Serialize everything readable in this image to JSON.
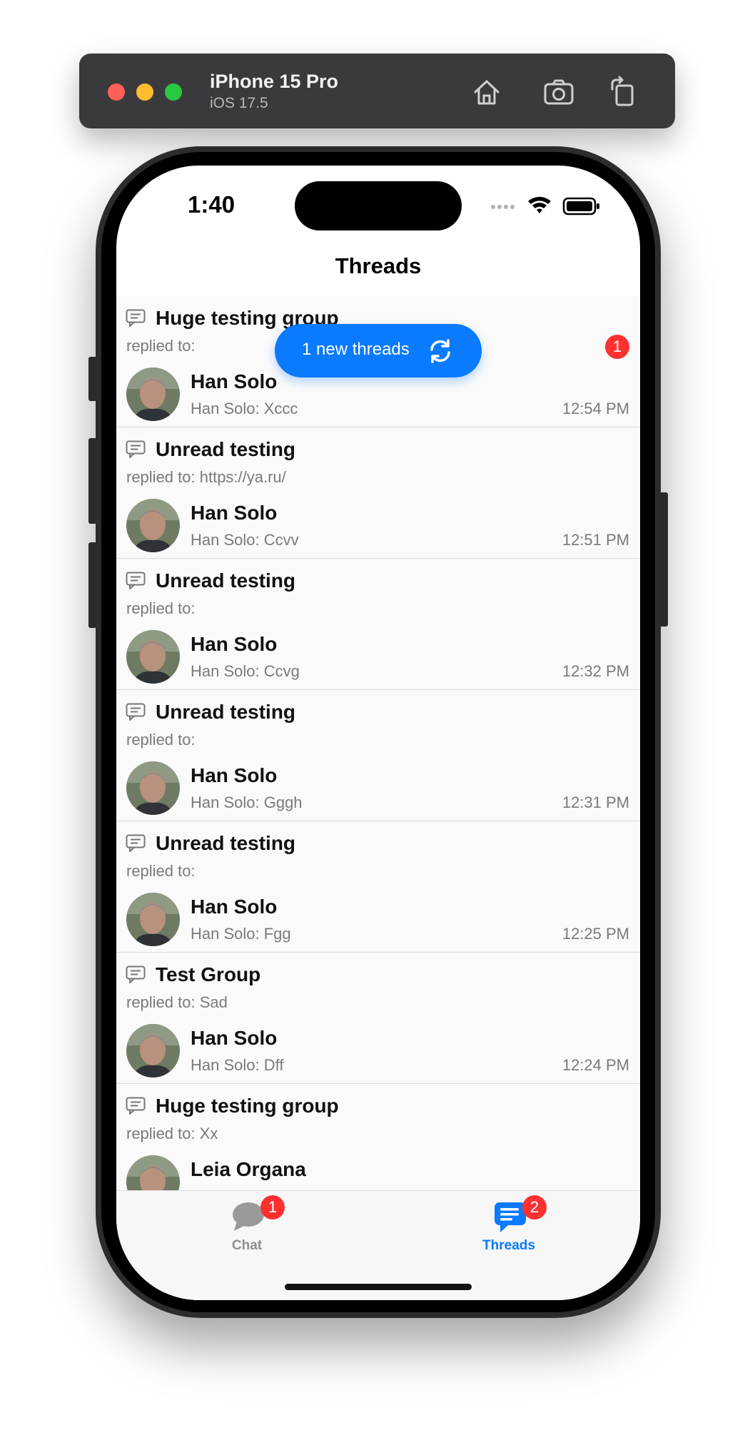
{
  "simulator": {
    "device": "iPhone 15 Pro",
    "os": "iOS 17.5",
    "toolbar_icons": [
      "home-icon",
      "screenshot-icon",
      "rotate-icon"
    ]
  },
  "status_bar": {
    "time": "1:40",
    "icons": [
      "cellular-dots-icon",
      "wifi-icon",
      "battery-icon"
    ]
  },
  "nav": {
    "title": "Threads"
  },
  "new_threads_button": {
    "label": "1 new threads",
    "icon": "refresh-icon"
  },
  "threads": [
    {
      "group": "Huge testing group",
      "replied": "replied to:",
      "author": "Han Solo",
      "preview": "Han Solo: Xccc",
      "time": "12:54 PM",
      "unread": "1"
    },
    {
      "group": "Unread testing",
      "replied": "replied to: https://ya.ru/",
      "author": "Han Solo",
      "preview": "Han Solo: Ccvv",
      "time": "12:51 PM"
    },
    {
      "group": "Unread testing",
      "replied": "replied to:",
      "author": "Han Solo",
      "preview": "Han Solo: Ccvg",
      "time": "12:32 PM"
    },
    {
      "group": "Unread testing",
      "replied": "replied to:",
      "author": "Han Solo",
      "preview": "Han Solo: Gggh",
      "time": "12:31 PM"
    },
    {
      "group": "Unread testing",
      "replied": "replied to:",
      "author": "Han Solo",
      "preview": "Han Solo: Fgg",
      "time": "12:25 PM"
    },
    {
      "group": "Test Group",
      "replied": "replied to: Sad",
      "author": "Han Solo",
      "preview": "Han Solo: Dff",
      "time": "12:24 PM"
    },
    {
      "group": "Huge testing group",
      "replied": "replied to: Xx",
      "author": "Leia Organa",
      "preview": "",
      "time": ""
    }
  ],
  "tabs": [
    {
      "label": "Chat",
      "badge": "1",
      "icon": "chat-bubble-icon"
    },
    {
      "label": "Threads",
      "badge": "2",
      "icon": "threads-icon"
    }
  ],
  "colors": {
    "accent": "#0a7aff",
    "badge": "#ff3030",
    "inactive_tab": "#8e8e93"
  }
}
